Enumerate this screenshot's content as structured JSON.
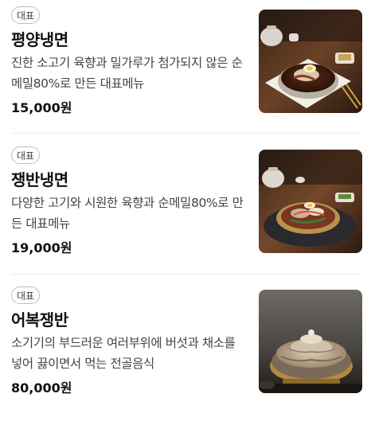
{
  "menu": {
    "items": [
      {
        "badge": "대표",
        "name": "평양냉면",
        "description": "진한 소고기 육향과 밀가루가 첨가되지 않은 순메밀80%로 만든 대표메뉴",
        "price": "15,000원",
        "image_icon": "pyongyang-naengmyeon-photo"
      },
      {
        "badge": "대표",
        "name": "쟁반냉면",
        "description": "다양한 고기와 시원한 육향과 순메밀80%로 만든 대표메뉴",
        "price": "19,000원",
        "image_icon": "jaengban-naengmyeon-photo"
      },
      {
        "badge": "대표",
        "name": "어복쟁반",
        "description": "소기기의 부드러운 여러부위에 버섯과 채소를 넣어 끓이면서 먹는 전골음식",
        "price": "80,000원",
        "image_icon": "eobok-jaengban-photo"
      }
    ]
  }
}
